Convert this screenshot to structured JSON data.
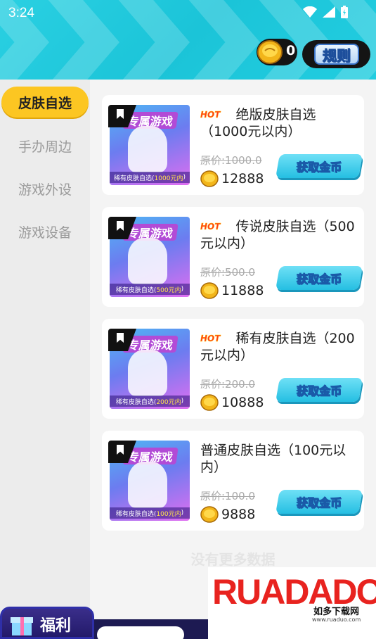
{
  "status_bar": {
    "time": "3:24"
  },
  "header": {
    "coin_count": "0",
    "rules_label": "规则"
  },
  "sidebar": {
    "items": [
      {
        "label": "皮肤自选",
        "active": true
      },
      {
        "label": "手办周边",
        "active": false
      },
      {
        "label": "游戏外设",
        "active": false
      },
      {
        "label": "游戏设备",
        "active": false
      }
    ]
  },
  "products": [
    {
      "hot": "HOT",
      "title": "绝版皮肤自选（1000元以内）",
      "thumb_logo": "专属游戏",
      "thumb_caption_pre": "稀有皮肤自选(",
      "thumb_caption_hl": "1000元内",
      "thumb_caption_post": ")",
      "original_price": "原价:1000.0",
      "price": "12888",
      "button_label": "获取金币"
    },
    {
      "hot": "HOT",
      "title": "传说皮肤自选（500元以内）",
      "thumb_logo": "专属游戏",
      "thumb_caption_pre": "稀有皮肤自选(",
      "thumb_caption_hl": "500元内",
      "thumb_caption_post": ")",
      "original_price": "原价:500.0",
      "price": "11888",
      "button_label": "获取金币"
    },
    {
      "hot": "HOT",
      "title": "稀有皮肤自选（200元以内）",
      "thumb_logo": "专属游戏",
      "thumb_caption_pre": "稀有皮肤自选(",
      "thumb_caption_hl": "200元内",
      "thumb_caption_post": ")",
      "original_price": "原价:200.0",
      "price": "10888",
      "button_label": "获取金币"
    },
    {
      "hot": "",
      "title": "普通皮肤自选（100元以内）",
      "thumb_logo": "专属游戏",
      "thumb_caption_pre": "稀有皮肤自选(",
      "thumb_caption_hl": "100元内",
      "thumb_caption_post": ")",
      "original_price": "原价:100.0",
      "price": "9888",
      "button_label": "获取金币"
    }
  ],
  "list_footer": "没有更多数据",
  "watermark": {
    "brand": "RUADADO",
    "cn": "如多下载网",
    "url": "www.ruaduo.com"
  },
  "bottom_nav": {
    "left_label": "福利"
  },
  "colors": {
    "header": "#22cde0",
    "active_tab": "#fcc622",
    "button": "#25bfe2"
  }
}
